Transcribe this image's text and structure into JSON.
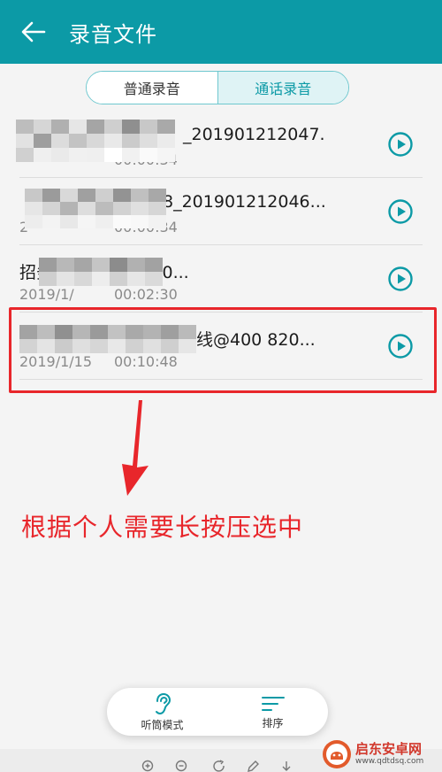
{
  "header": {
    "title": "录音文件",
    "back_icon": "arrow-left-icon",
    "background": "#0c9aa6"
  },
  "tabs": [
    {
      "label": "普通录音",
      "active": false
    },
    {
      "label": "通话录音",
      "active": true
    }
  ],
  "recordings": [
    {
      "name": "_201901212047...",
      "date": "",
      "duration": "00:00:34"
    },
    {
      "name": "8_201901212046...",
      "date": "2",
      "duration": "00:00:34"
    },
    {
      "name": "招务热线@400 820...",
      "date": "2019/1/",
      "duration": "00:02:30"
    },
    {
      "name": "线@400 820...",
      "date": "2019/1/15",
      "duration": "00:10:48"
    }
  ],
  "annotation": {
    "text": "根据个人需要长按压选中",
    "color": "#e8262b"
  },
  "bottom_bar": [
    {
      "label": "听筒模式",
      "icon": "ear-icon"
    },
    {
      "label": "排序",
      "icon": "sort-icon"
    }
  ],
  "watermark": {
    "name": "启东安卓网",
    "url": "www.qdtdsq.com"
  },
  "accent": "#0c9aa6"
}
